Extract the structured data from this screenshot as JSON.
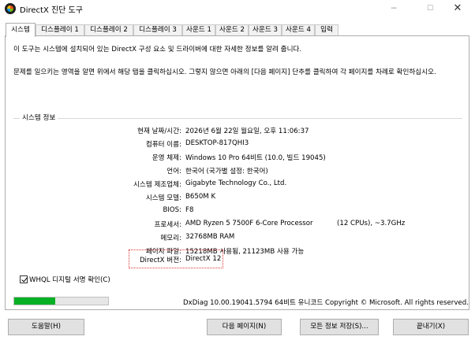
{
  "window": {
    "title": "DirectX 진단 도구",
    "minimize": "─",
    "maximize": "☐",
    "close": "✕",
    "icon": "directx-icon"
  },
  "tabs": [
    {
      "label": "시스템",
      "active": true
    },
    {
      "label": "디스플레이 1"
    },
    {
      "label": "디스플레이 2"
    },
    {
      "label": "디스플레이 3"
    },
    {
      "label": "사운드 1"
    },
    {
      "label": "사운드 2"
    },
    {
      "label": "사운드 3"
    },
    {
      "label": "사운드 4"
    },
    {
      "label": "입력"
    }
  ],
  "intro": {
    "line1": "이 도구는 시스템에 설치되어 있는 DirectX 구성 요소 및 드라이버에 대한 자세한 정보를 알려 줍니다.",
    "line2": "문제를 일으키는 영역을 알면 위에서 해당 탭을 클릭하십시오. 그렇지 않으면 아래의 [다음 페이지] 단추를 클릭하여 각 페이지를 차례로 확인하십시오."
  },
  "system_info": {
    "group_label": "시스템 정보",
    "rows": [
      {
        "label": "현재 날짜/시간:",
        "value": "2026년 6월 22일 월요일, 오후 11:06:37"
      },
      {
        "label": "컴퓨터 이름:",
        "value": "DESKTOP-817QHI3"
      },
      {
        "label": "운영 체제:",
        "value": "Windows 10 Pro 64비트 (10.0, 빌드 19045)"
      },
      {
        "label": "언어:",
        "value": "한국어 (국가별 설정: 한국어)"
      },
      {
        "label": "시스템 제조업체:",
        "value": "Gigabyte Technology Co., Ltd."
      },
      {
        "label": "시스템 모델:",
        "value": "B650M K"
      },
      {
        "label": "BIOS:",
        "value": "F8"
      },
      {
        "label": "프로세서:",
        "value": "AMD Ryzen 5 7500F 6-Core Processor",
        "extra": "(12 CPUs), ~3.7GHz"
      },
      {
        "label": "메모리:",
        "value": "32768MB RAM"
      },
      {
        "label": "페이지 파일:",
        "value": "15218MB 사용됨, 21123MB 사용 가능"
      },
      {
        "label": "DirectX 버전:",
        "value": "DirectX 12"
      }
    ]
  },
  "whql": {
    "label": "WHQL 디지털 서명 확인(C)",
    "checked": true
  },
  "progress": {
    "fraction": 0.44
  },
  "footer": {
    "text": "DxDiag 10.00.19041.5794 64비트 유니코드  Copyright © Microsoft. All rights reserved."
  },
  "buttons": {
    "help": "도움말(H)",
    "next": "다음 페이지(N)",
    "save": "모든 정보 저장(S)...",
    "exit": "끝내기(X)"
  }
}
